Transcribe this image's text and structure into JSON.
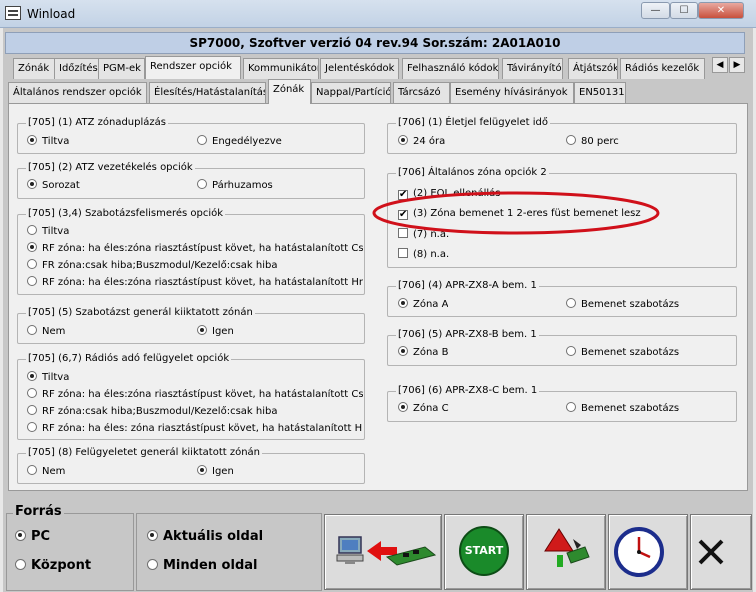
{
  "window": {
    "title": "Winload"
  },
  "header": {
    "text": "SP7000, Szoftver verzió 04 rev.94 Sor.szám: 2A01A010"
  },
  "main_tabs": [
    "Zónák",
    "Időzítés",
    "PGM-ek",
    "Rendszer opciók",
    "Kommunikátor",
    "Jelentéskódok",
    "Felhasználó kódok",
    "Távirányító",
    "Átjátszók",
    "Rádiós kezelők"
  ],
  "sub_tabs": [
    "Általános rendszer opciók",
    "Élesítés/Hatástalanítás",
    "Zónák",
    "Nappal/Partíció",
    "Tárcsázó",
    "Esemény hívásirányok",
    "EN50131"
  ],
  "left": {
    "g1": {
      "title": "[705] (1) ATZ zónaduplázás",
      "options": [
        "Tiltva",
        "Engedélyezve"
      ],
      "selected": "Tiltva"
    },
    "g2": {
      "title": "[705] (2) ATZ vezetékelés opciók",
      "options": [
        "Sorozat",
        "Párhuzamos"
      ],
      "selected": "Sorozat"
    },
    "g3": {
      "title": "[705] (3,4) Szabotázsfelismerés opciók",
      "options": [
        "Tiltva",
        "RF zóna: ha éles:zóna riasztástípust követ, ha hatástalanított Csak",
        "FR zóna:csak hiba;Buszmodul/Kezelő:csak hiba",
        "RF zóna: ha éles:zóna riasztástípust követ, ha hatástalanított Hnag"
      ],
      "selected": "RF zóna: ha éles:zóna riasztástípust követ, ha hatástalanított Csak"
    },
    "g4": {
      "title": "[705] (5) Szabotázst generál kiiktatott zónán",
      "options": [
        "Nem",
        "Igen"
      ],
      "selected": "Igen"
    },
    "g5": {
      "title": "[705] (6,7) Rádiós adó felügyelet opciók",
      "options": [
        "Tiltva",
        "RF zóna: ha éles:zóna riasztástípust követ, ha hatástalanított Csak",
        "RF zóna:csak hiba;Buszmodul/Kezelő:csak hiba",
        "RF zóna: ha éles: zóna riasztástípust követ, ha hatástalanított Hnag"
      ],
      "selected": "Tiltva"
    },
    "g6": {
      "title": "[705] (8) Felügyeletet generál kiiktatott zónán",
      "options": [
        "Nem",
        "Igen"
      ],
      "selected": "Igen"
    }
  },
  "right": {
    "g1": {
      "title": "[706] (1) Életjel felügyelet idő",
      "options": [
        "24 óra",
        "80 perc"
      ],
      "selected": "24 óra"
    },
    "g2": {
      "title": "[706] Általános zóna opciók 2",
      "items": [
        "(2) EOL ellenállás",
        "(3) Zóna bemenet 1 2-eres füst bemenet lesz",
        "(7) n.a.",
        "(8) n.a."
      ],
      "checked": [
        true,
        true,
        false,
        false
      ]
    },
    "g3": {
      "title": "[706] (4) APR-ZX8-A bem. 1",
      "options": [
        "Zóna A",
        "Bemenet szabotázs"
      ],
      "selected": "Zóna A"
    },
    "g4": {
      "title": "[706] (5) APR-ZX8-B bem. 1",
      "options": [
        "Zóna B",
        "Bemenet szabotázs"
      ],
      "selected": "Zóna B"
    },
    "g5": {
      "title": "[706] (6) APR-ZX8-C bem. 1",
      "options": [
        "Zóna C",
        "Bemenet szabotázs"
      ],
      "selected": "Zóna C"
    }
  },
  "bottom": {
    "source_title": "Forrás",
    "source_options": [
      "PC",
      "Központ"
    ],
    "source_selected": "PC",
    "page_options": [
      "Aktuális oldal",
      "Minden oldal"
    ],
    "page_selected": "Aktuális oldal",
    "start_label": "START"
  },
  "colors": {
    "highlight": "#d0101a",
    "start_green": "#1a8a2a",
    "header_bg": "#bfcfe6"
  }
}
